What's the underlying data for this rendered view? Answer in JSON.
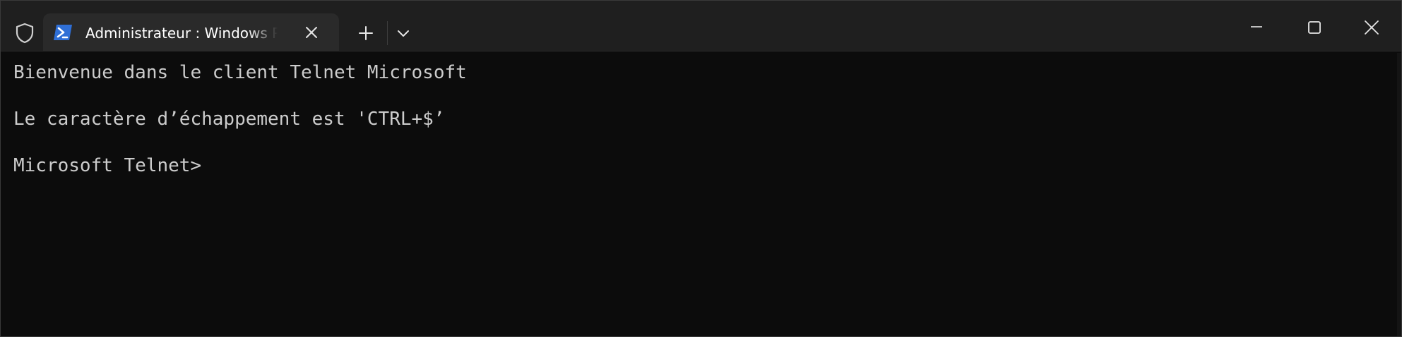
{
  "window": {
    "tab_title": "Administrateur : Windows PowerShell",
    "tab_icon": "powershell-icon",
    "titlebar_icons": [
      "shield-icon",
      "plus-icon",
      "chevron-down-icon",
      "minimize-icon",
      "maximize-icon",
      "close-icon"
    ]
  },
  "terminal": {
    "lines": [
      "Bienvenue dans le client Telnet Microsoft",
      "",
      "Le caractère d’échappement est 'CTRL+$’",
      "",
      "Microsoft Telnet>"
    ]
  },
  "colors": {
    "terminal_bg": "#0c0c0c",
    "titlebar_bg": "#1f1f1f",
    "tab_bg": "#2a2a2a",
    "text": "#cccccc",
    "powershell_blue": "#2f6fd6"
  }
}
